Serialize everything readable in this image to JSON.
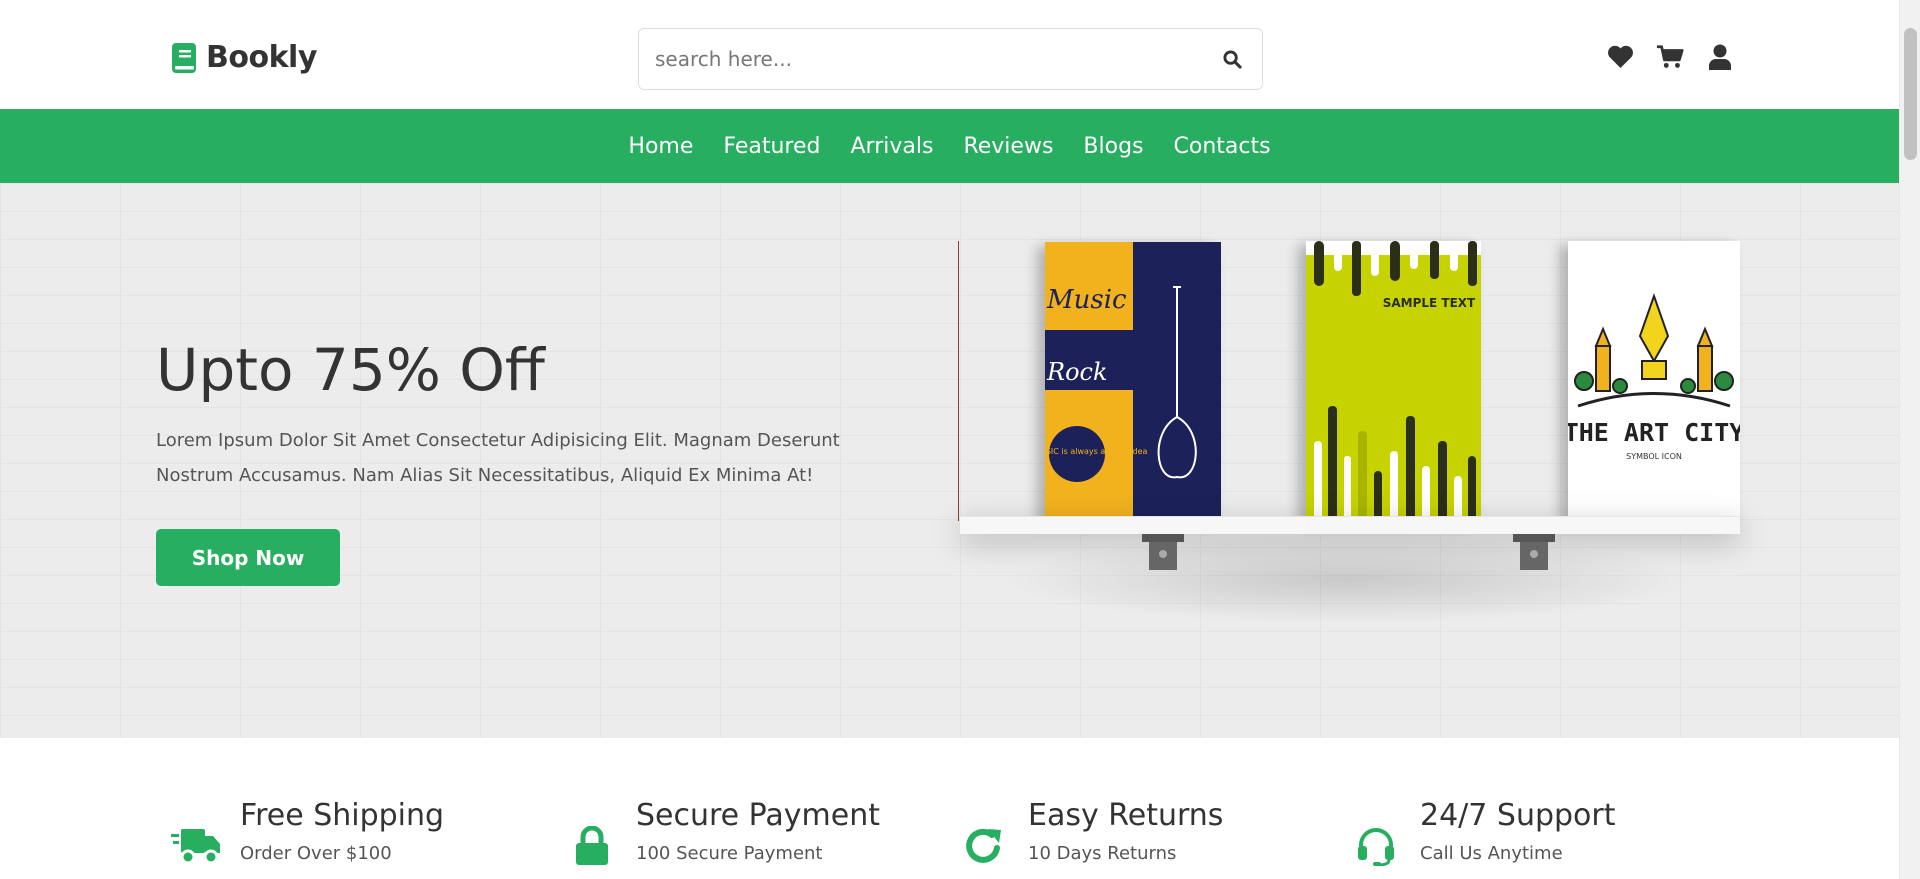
{
  "brand": {
    "name": "Bookly",
    "color": "#27ae60"
  },
  "search": {
    "placeholder": "search here..."
  },
  "header_icons": [
    "heart-icon",
    "cart-icon",
    "user-icon"
  ],
  "nav": {
    "items": [
      "Home",
      "Featured",
      "Arrivals",
      "Reviews",
      "Blogs",
      "Contacts"
    ]
  },
  "hero": {
    "title": "Upto 75% Off",
    "text": "Lorem Ipsum Dolor Sit Amet Consectetur Adipisicing Elit. Magnam Deserunt Nostrum Accusamus. Nam Alias Sit Necessitatibus, Aliquid Ex Minima At!",
    "button": "Shop Now",
    "books": [
      {
        "cover": "Music",
        "words": [
          "Music",
          "Rock",
          "Listen MUSIC is always a good idea"
        ]
      },
      {
        "cover": "Sample",
        "words": [
          "SAMPLE TEXT"
        ]
      },
      {
        "cover": "Art",
        "words": [
          "THE ART CITY",
          "SYMBOL ICON"
        ]
      }
    ]
  },
  "features": [
    {
      "icon": "truck-icon",
      "title": "Free Shipping",
      "subtitle": "Order Over $100"
    },
    {
      "icon": "lock-icon",
      "title": "Secure Payment",
      "subtitle": "100 Secure Payment"
    },
    {
      "icon": "redo-icon",
      "title": "Easy Returns",
      "subtitle": "10 Days Returns"
    },
    {
      "icon": "headset-icon",
      "title": "24/7 Support",
      "subtitle": "Call Us Anytime"
    }
  ]
}
